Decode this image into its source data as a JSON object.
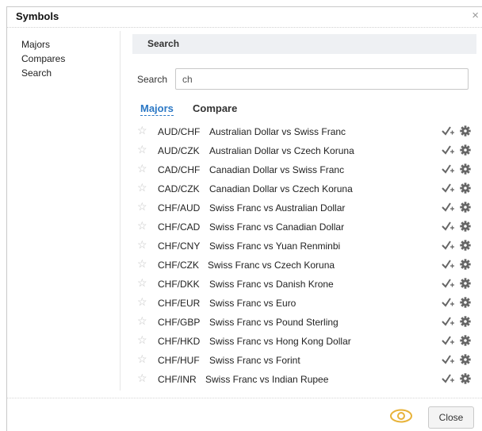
{
  "dialog": {
    "title": "Symbols",
    "close_icon": "×"
  },
  "sidebar": {
    "items": [
      {
        "label": "Majors"
      },
      {
        "label": "Compares"
      },
      {
        "label": "Search"
      }
    ]
  },
  "search": {
    "header": "Search",
    "label": "Search",
    "value": "ch"
  },
  "tabs": [
    {
      "label": "Majors",
      "active": true
    },
    {
      "label": "Compare",
      "active": false
    }
  ],
  "rows": [
    {
      "symbol": "AUD/CHF",
      "desc": "Australian Dollar vs Swiss Franc"
    },
    {
      "symbol": "AUD/CZK",
      "desc": "Australian Dollar vs Czech Koruna"
    },
    {
      "symbol": "CAD/CHF",
      "desc": "Canadian Dollar vs Swiss Franc"
    },
    {
      "symbol": "CAD/CZK",
      "desc": "Canadian Dollar vs Czech Koruna"
    },
    {
      "symbol": "CHF/AUD",
      "desc": "Swiss Franc vs Australian Dollar"
    },
    {
      "symbol": "CHF/CAD",
      "desc": "Swiss Franc vs Canadian Dollar"
    },
    {
      "symbol": "CHF/CNY",
      "desc": "Swiss Franc vs Yuan Renminbi"
    },
    {
      "symbol": "CHF/CZK",
      "desc": "Swiss Franc vs Czech Koruna"
    },
    {
      "symbol": "CHF/DKK",
      "desc": "Swiss Franc vs Danish Krone"
    },
    {
      "symbol": "CHF/EUR",
      "desc": "Swiss Franc vs Euro"
    },
    {
      "symbol": "CHF/GBP",
      "desc": "Swiss Franc vs Pound Sterling"
    },
    {
      "symbol": "CHF/HKD",
      "desc": "Swiss Franc vs Hong Kong Dollar"
    },
    {
      "symbol": "CHF/HUF",
      "desc": "Swiss Franc vs Forint"
    },
    {
      "symbol": "CHF/INR",
      "desc": "Swiss Franc vs Indian Rupee"
    }
  ],
  "row_icons": {
    "favorite": "star-outline-icon",
    "add": "check-plus-icon",
    "settings": "gear-icon"
  },
  "footer": {
    "eye_icon": "eye-icon",
    "close_label": "Close"
  },
  "colors": {
    "accent": "#2b78c5",
    "eye": "#e8b33a"
  }
}
